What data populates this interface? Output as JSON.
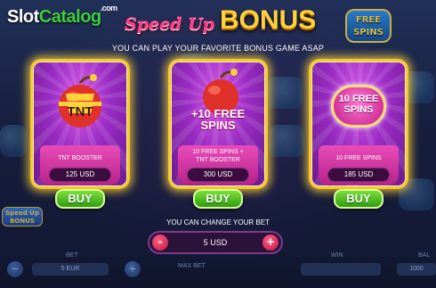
{
  "logo": {
    "part1": "Slot",
    "part2": "Catalog",
    "suffix": ".com"
  },
  "header": {
    "title_script": "Speed Up",
    "title_main": "BONUS",
    "subtitle": "YOU CAN PLAY YOUR FAVORITE BONUS GAME ASAP",
    "corner_badge": "FREE SPINS"
  },
  "cards": [
    {
      "art_text": "TNT",
      "description": "TNT BOOSTER",
      "price": "125 USD",
      "buy_label": "BUY",
      "icon": "tnt-apple-bomb-icon"
    },
    {
      "art_text": "+10 FREE SPINS",
      "description": "10 FREE SPINS + TNT BOOSTER",
      "price": "300 USD",
      "buy_label": "BUY",
      "icon": "apple-bomb-free-spins-icon"
    },
    {
      "art_text": "10 FREE SPINS",
      "description": "10 FREE SPINS",
      "price": "185 USD",
      "buy_label": "BUY",
      "icon": "free-spins-badge-icon"
    }
  ],
  "bet": {
    "label": "YOU CAN CHANGE YOUR BET",
    "value": "5 USD",
    "minus": "-",
    "plus": "+"
  },
  "background_bar": {
    "bet_label": "BET",
    "bet_value": "5 EUR",
    "max_bet": "MAX BET",
    "win_label": "WIN",
    "balance_label": "BAL",
    "balance_value": "1000",
    "side_bonus": "Speed Up BONUS"
  },
  "colors": {
    "gold": "#f6c92d",
    "card_purple": "#9a2cc4",
    "buy_green": "#3fb51a",
    "bet_red": "#c4124a"
  }
}
